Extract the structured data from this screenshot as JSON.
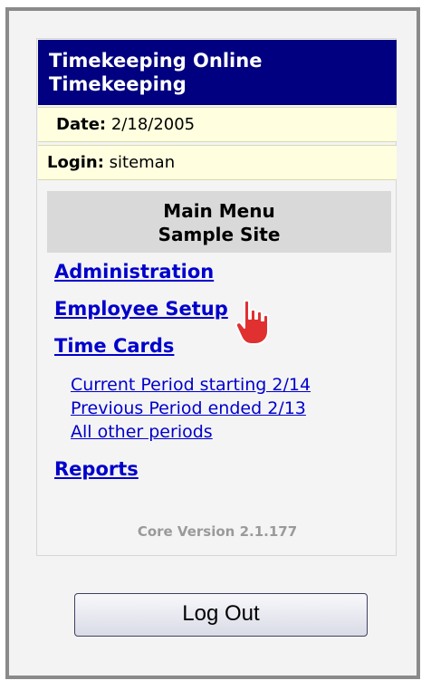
{
  "header": {
    "line1": "Timekeeping Online",
    "line2": "Timekeeping"
  },
  "date": {
    "label": "Date:",
    "value": "2/18/2005"
  },
  "login": {
    "label": "Login:",
    "value": "siteman"
  },
  "menu": {
    "title": "Main Menu",
    "site": "Sample Site"
  },
  "nav": {
    "administration": "Administration",
    "employee_setup": "Employee Setup",
    "time_cards": "Time Cards",
    "time_card_links": [
      "Current Period starting 2/14",
      "Previous Period ended 2/13",
      "All other periods"
    ],
    "reports": "Reports"
  },
  "version": "Core Version 2.1.177",
  "logout_label": "Log Out",
  "cursor_icon": "hand-pointer-icon"
}
